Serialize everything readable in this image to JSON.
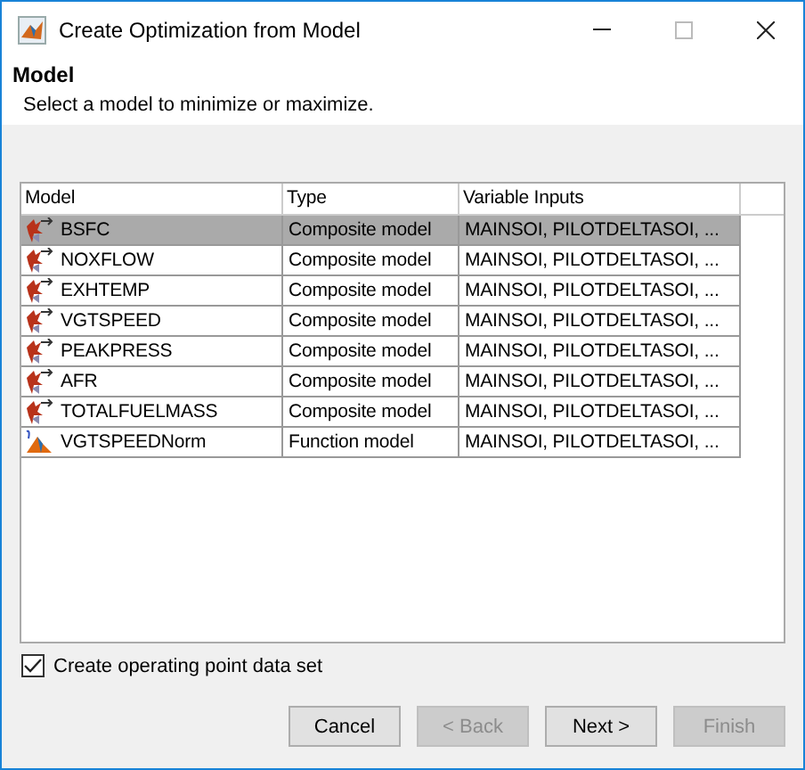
{
  "window": {
    "title": "Create Optimization from Model"
  },
  "header": {
    "title": "Model",
    "subtitle": "Select a model to minimize or maximize."
  },
  "table": {
    "columns": [
      "Model",
      "Type",
      "Variable Inputs"
    ],
    "rows": [
      {
        "name": "BSFC",
        "type": "Composite model",
        "inputs": "MAINSOI, PILOTDELTASOI, ...",
        "kind": "composite",
        "selected": true
      },
      {
        "name": "NOXFLOW",
        "type": "Composite model",
        "inputs": "MAINSOI, PILOTDELTASOI, ...",
        "kind": "composite",
        "selected": false
      },
      {
        "name": "EXHTEMP",
        "type": "Composite model",
        "inputs": "MAINSOI, PILOTDELTASOI, ...",
        "kind": "composite",
        "selected": false
      },
      {
        "name": "VGTSPEED",
        "type": "Composite model",
        "inputs": "MAINSOI, PILOTDELTASOI, ...",
        "kind": "composite",
        "selected": false
      },
      {
        "name": "PEAKPRESS",
        "type": "Composite model",
        "inputs": "MAINSOI, PILOTDELTASOI, ...",
        "kind": "composite",
        "selected": false
      },
      {
        "name": "AFR",
        "type": "Composite model",
        "inputs": "MAINSOI, PILOTDELTASOI, ...",
        "kind": "composite",
        "selected": false
      },
      {
        "name": "TOTALFUELMASS",
        "type": "Composite model",
        "inputs": "MAINSOI, PILOTDELTASOI, ...",
        "kind": "composite",
        "selected": false
      },
      {
        "name": "VGTSPEEDNorm",
        "type": "Function model",
        "inputs": "MAINSOI, PILOTDELTASOI, ...",
        "kind": "function",
        "selected": false
      }
    ]
  },
  "checkbox": {
    "label": "Create operating point data set",
    "checked": true
  },
  "buttons": [
    {
      "label": "Cancel",
      "disabled": false
    },
    {
      "label": "< Back",
      "disabled": true
    },
    {
      "label": "Next >",
      "disabled": false
    },
    {
      "label": "Finish",
      "disabled": true
    }
  ]
}
